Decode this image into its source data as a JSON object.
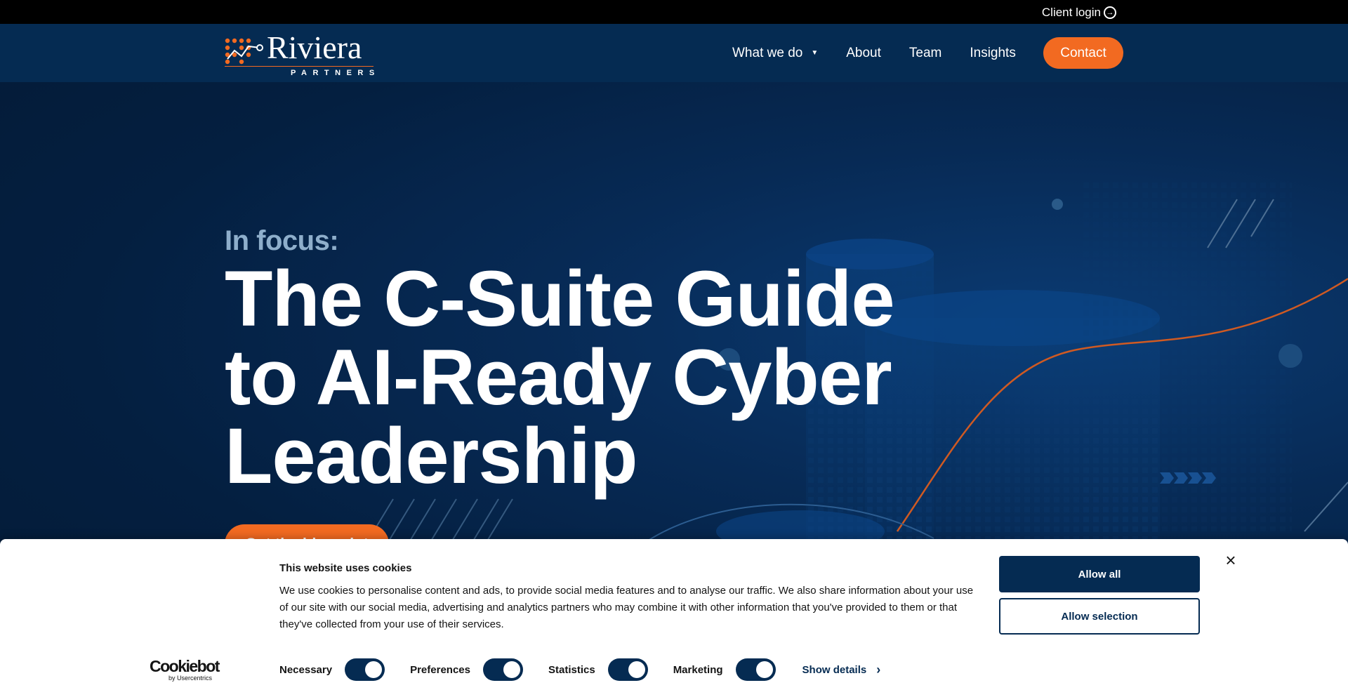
{
  "topbar": {
    "client_login": "Client login"
  },
  "logo": {
    "word": "Riviera",
    "sub": "PARTNERS"
  },
  "nav": {
    "items": [
      {
        "label": "What we do",
        "has_dropdown": true
      },
      {
        "label": "About"
      },
      {
        "label": "Team"
      },
      {
        "label": "Insights"
      }
    ],
    "contact": "Contact"
  },
  "hero": {
    "kicker": "In focus:",
    "headline": "The C-Suite Guide to AI-Ready Cyber Leadership",
    "cta": "Get the blueprint"
  },
  "cookie": {
    "title": "This website uses cookies",
    "text": "We use cookies to personalise content and ads, to provide social media features and to analyse our traffic. We also share information about your use of our site with our social media, advertising and analytics partners who may combine it with other information that you've provided to them or that they've collected from your use of their services.",
    "allow_all": "Allow all",
    "allow_selection": "Allow selection",
    "close": "×",
    "brand": "Cookiebot",
    "brand_sub": "by Usercentrics",
    "toggles": [
      {
        "label": "Necessary",
        "checked": true
      },
      {
        "label": "Preferences",
        "checked": true
      },
      {
        "label": "Statistics",
        "checked": true
      },
      {
        "label": "Marketing",
        "checked": true
      }
    ],
    "show_details": "Show details"
  },
  "colors": {
    "navy": "#052b52",
    "orange": "#f26a21",
    "kicker": "#8eaecb"
  },
  "icons": {
    "client_login": "arrow-right-circle-icon",
    "dropdown": "caret-down-icon",
    "details": "chevron-right-icon",
    "close": "close-icon"
  }
}
